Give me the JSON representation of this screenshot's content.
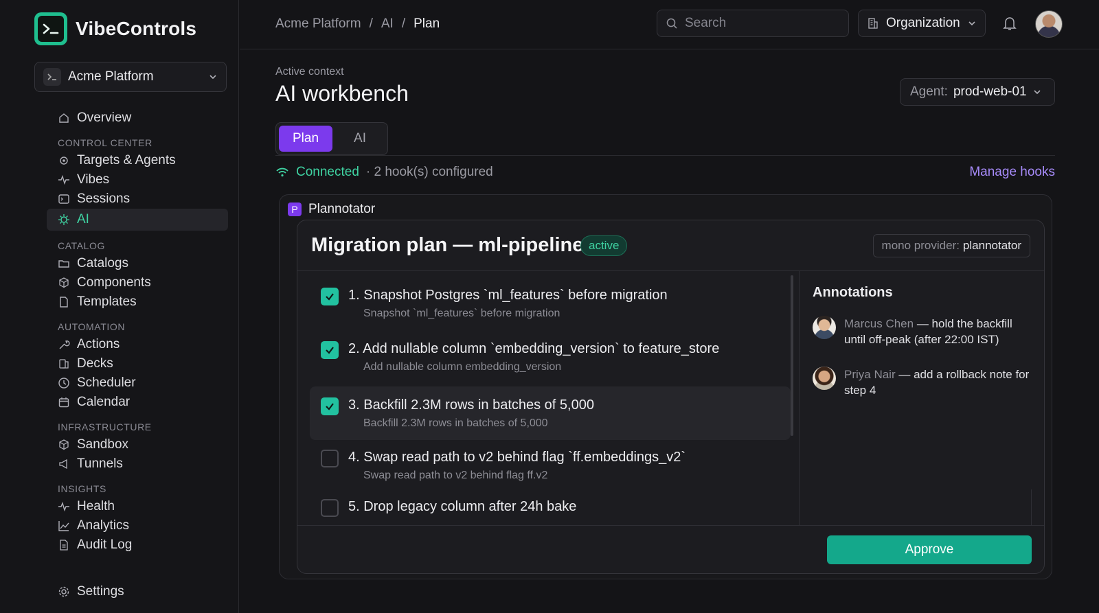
{
  "app": {
    "name": "VibeControls",
    "brand_color": "#1fbf8f"
  },
  "workspace": {
    "name": "Acme Platform"
  },
  "sidebar": {
    "overview": "Overview",
    "sections": [
      {
        "title": "CONTROL CENTER",
        "items": [
          "Targets & Agents",
          "Vibes",
          "Sessions",
          "AI"
        ]
      },
      {
        "title": "CATALOG",
        "items": [
          "Catalogs",
          "Components",
          "Templates"
        ]
      },
      {
        "title": "AUTOMATION",
        "items": [
          "Actions",
          "Decks",
          "Scheduler",
          "Calendar"
        ]
      },
      {
        "title": "INFRASTRUCTURE",
        "items": [
          "Sandbox",
          "Tunnels"
        ]
      },
      {
        "title": "INSIGHTS",
        "items": [
          "Health",
          "Analytics",
          "Audit Log"
        ]
      }
    ],
    "active_item": "AI",
    "settings": "Settings"
  },
  "header": {
    "breadcrumb": [
      "Acme Platform",
      "/",
      "AI",
      "/",
      "Plan"
    ],
    "search_placeholder": "Search",
    "org_label": "Organization"
  },
  "main": {
    "eyebrow": "Active context",
    "title": "AI workbench",
    "agent_prefix": "Agent:",
    "agent_value": "prod-web-01",
    "tabs": [
      "Plan",
      "AI"
    ],
    "status_connected": "Connected",
    "status_hooks": "· 2 hook(s) configured",
    "manage_hooks": "Manage hooks"
  },
  "plannotator": {
    "badge": "P",
    "label": "Plannotator",
    "plan_title": "Migration plan — ml-pipeline",
    "plan_status": "active",
    "provider_prefix": "mono provider:",
    "provider_value": "plannotator",
    "steps": [
      {
        "title": "1. Snapshot Postgres `ml_features` before migration",
        "sub": "Snapshot `ml_features` before migration",
        "checked": true
      },
      {
        "title": "2. Add nullable column `embedding_version` to feature_store",
        "sub": "Add nullable column embedding_version",
        "checked": true
      },
      {
        "title": "3. Backfill 2.3M rows in batches of 5,000",
        "sub": "Backfill 2.3M rows in batches of 5,000",
        "checked": true
      },
      {
        "title": "4. Swap read path to v2 behind flag `ff.embeddings_v2`",
        "sub": "Swap read path to v2 behind flag ff.v2",
        "checked": false
      },
      {
        "title": "5. Drop legacy column after 24h bake",
        "sub": "",
        "checked": false
      }
    ],
    "annotations_title": "Annotations",
    "annotations": [
      {
        "author": "Marcus Chen",
        "text": " — hold the backfill until off-peak (after 22:00 IST)"
      },
      {
        "author": "Priya Nair",
        "text": " — add a rollback note for step 4"
      }
    ],
    "approve": "Approve"
  },
  "colors": {
    "accent_purple": "#7c3aed",
    "accent_green": "#3fd3a2",
    "approve": "#14a88b"
  }
}
